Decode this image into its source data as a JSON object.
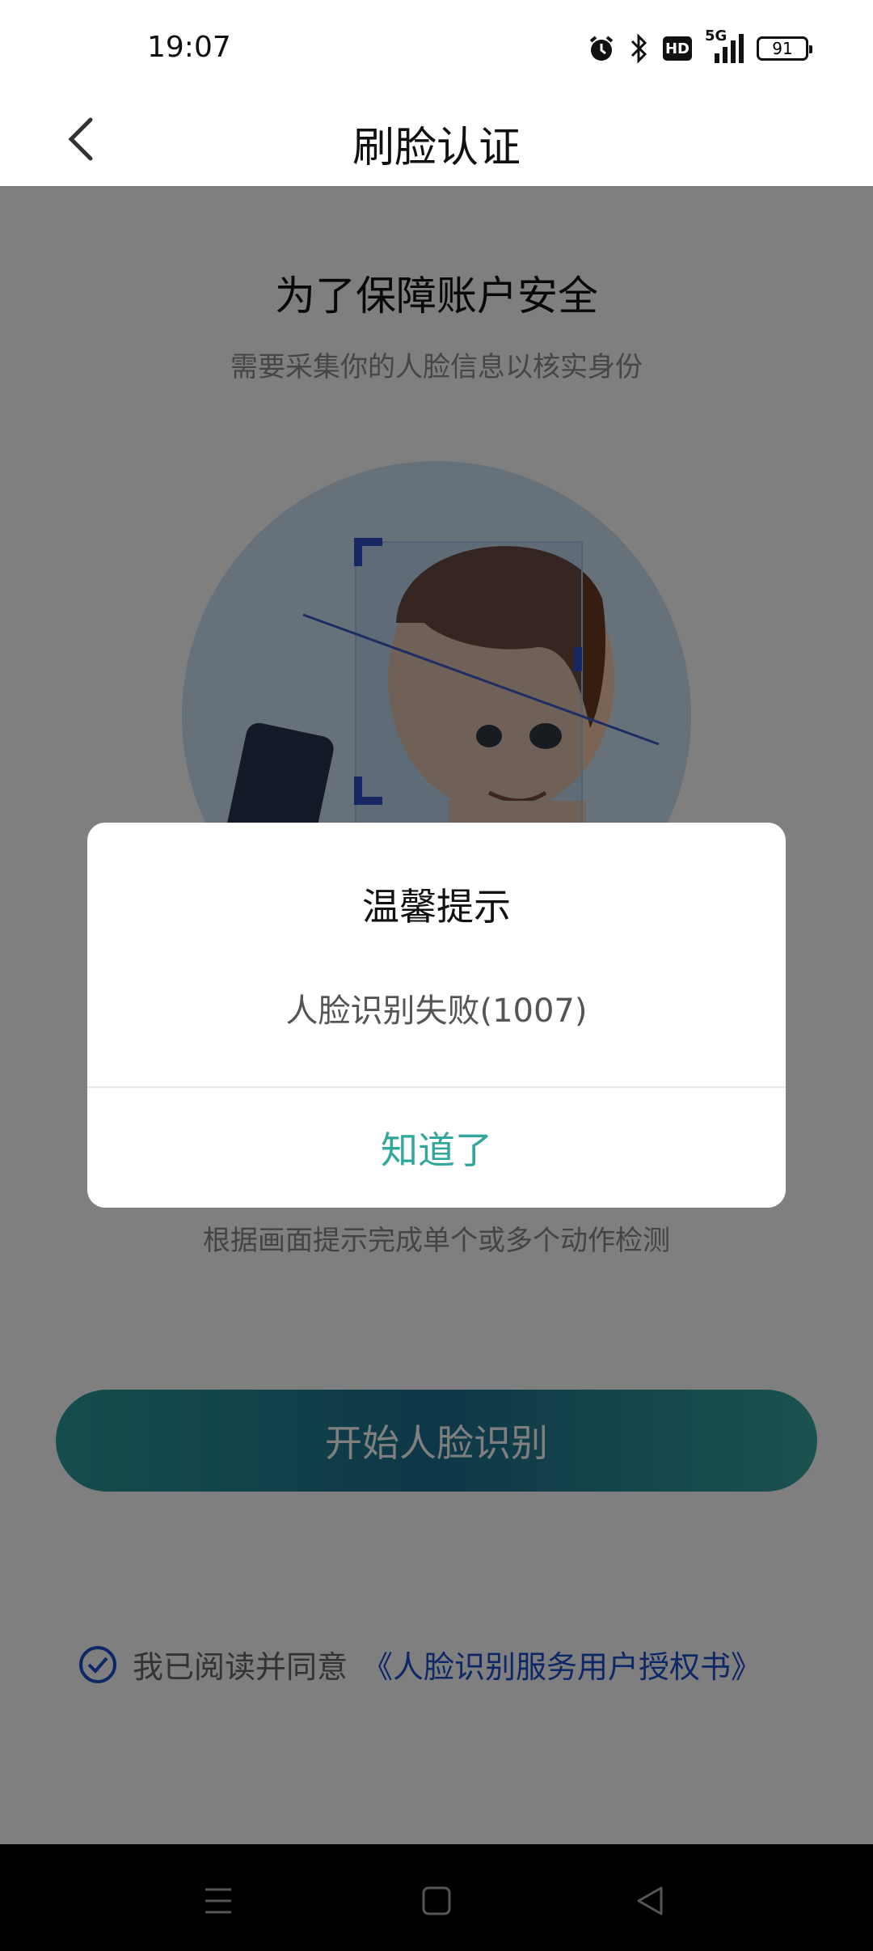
{
  "status_bar": {
    "time": "19:07",
    "icons": [
      "alarm-icon",
      "bluetooth-icon",
      "hd-icon",
      "signal-5g-icon",
      "battery-icon"
    ],
    "hd_label": "HD",
    "network_label": "5G",
    "battery_level": "91"
  },
  "header": {
    "title": "刷脸认证",
    "back_icon": "chevron-left-icon"
  },
  "main": {
    "title": "为了保障账户安全",
    "subtitle": "需要采集你的人脸信息以核实身份",
    "detect_hint": "根据画面提示完成单个或多个动作检测",
    "start_button": "开始人脸识别",
    "agreement_text": "我已阅读并同意",
    "agreement_link": "《人脸识别服务用户授权书》",
    "agreement_checked": true
  },
  "dialog": {
    "title": "温馨提示",
    "message": "人脸识别失败(1007)",
    "ok_button": "知道了"
  },
  "nav_bar": {
    "icons": [
      "menu-icon",
      "home-icon",
      "back-icon"
    ]
  },
  "colors": {
    "accent_teal": "#2fa79a",
    "link_blue": "#1a4fcf",
    "button_gradient_start": "#2b9a9b",
    "button_gradient_mid": "#1d6f8f",
    "scrim": "rgba(0,0,0,0.5)"
  }
}
